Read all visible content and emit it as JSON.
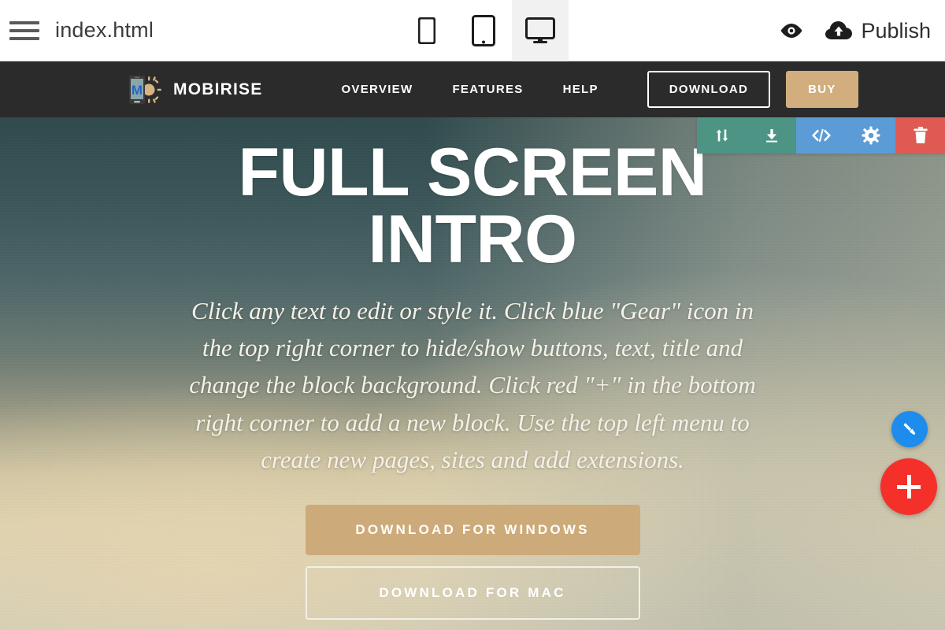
{
  "topbar": {
    "menu_icon": "hamburger-menu-icon",
    "file_title": "index.html",
    "devices": [
      {
        "id": "mobile",
        "icon": "mobile-phone-icon",
        "active": false
      },
      {
        "id": "tablet",
        "icon": "tablet-icon",
        "active": false
      },
      {
        "id": "desktop",
        "icon": "desktop-monitor-icon",
        "active": true
      }
    ],
    "preview_icon": "eye-icon",
    "publish_icon": "cloud-upload-icon",
    "publish_label": "Publish"
  },
  "site_nav": {
    "brand_name": "MOBIRISE",
    "brand_logo_letter": "M",
    "brand_logo_icon": "mobirise-phone-sun-logo",
    "links": [
      {
        "label": "OVERVIEW"
      },
      {
        "label": "FEATURES"
      },
      {
        "label": "HELP"
      }
    ],
    "download_label": "DOWNLOAD",
    "buy_label": "BUY",
    "background_color": "#2b2b2b",
    "buy_color": "#d2ae7e"
  },
  "block_toolbar": {
    "items": [
      {
        "id": "move",
        "icon": "move-up-down-arrows-icon",
        "color": "#4d9484"
      },
      {
        "id": "save",
        "icon": "download-arrow-icon",
        "color": "#4d9484"
      },
      {
        "id": "code",
        "icon": "code-brackets-icon",
        "color": "#5c9cd6"
      },
      {
        "id": "gear",
        "icon": "gear-settings-icon",
        "color": "#5c9cd6"
      },
      {
        "id": "trash",
        "icon": "trash-delete-icon",
        "color": "#df5a52"
      }
    ]
  },
  "hero": {
    "title": "FULL SCREEN INTRO",
    "paragraph": "Click any text to edit or style it. Click blue \"Gear\" icon in the top right corner to hide/show buttons, text, title and change the block background. Click red \"+\" in the bottom right corner to add a new block. Use the top left menu to create new pages, sites and add extensions.",
    "cta_primary": "DOWNLOAD FOR WINDOWS",
    "cta_secondary": "DOWNLOAD FOR MAC",
    "cta_primary_color": "#cdaa79"
  },
  "fabs": [
    {
      "id": "style",
      "icon": "paintbrush-icon",
      "color": "#1d8cec"
    },
    {
      "id": "add-block",
      "icon": "plus-icon",
      "color": "#f5302a"
    }
  ]
}
